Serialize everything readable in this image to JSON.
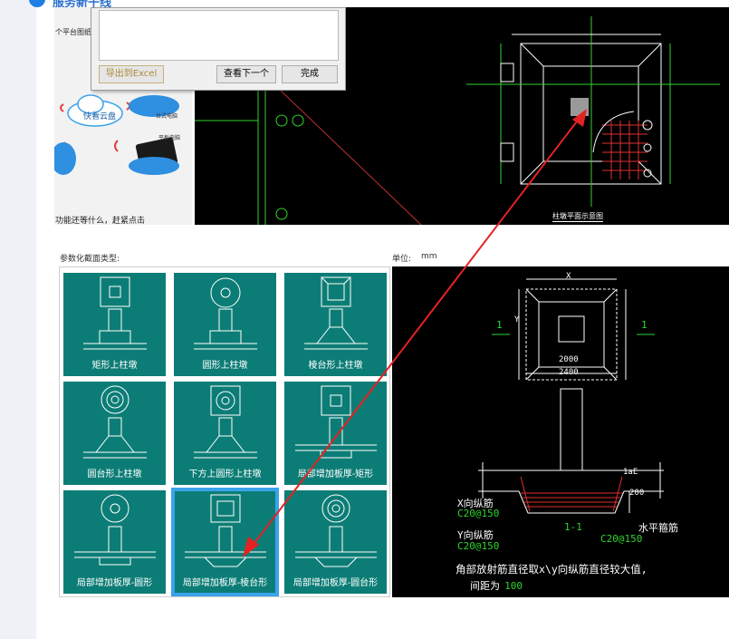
{
  "top": {
    "brand": "服务新干线"
  },
  "left_panel": {
    "title": "个平台图纸",
    "cloud_label": "快看云盘",
    "device_label_1": "台式电脑",
    "device_label_2": "平板电脑",
    "footer_text": "功能还等什么，赶紧点击"
  },
  "dialog": {
    "export_label": "导出到Excel",
    "next_label": "查看下一个",
    "done_label": "完成"
  },
  "cad_top": {
    "label_1": "柱墩平面示意图"
  },
  "section_title": "参数化截面类型:",
  "unit_label": "单位:",
  "unit_value": "mm",
  "tiles": [
    {
      "label": "矩形上柱墩"
    },
    {
      "label": "圆形上柱墩"
    },
    {
      "label": "棱台形上柱墩"
    },
    {
      "label": "圆台形上柱墩"
    },
    {
      "label": "下方上圆形上柱墩"
    },
    {
      "label": "局部增加板厚-矩形"
    },
    {
      "label": "局部增加板厚-圆形"
    },
    {
      "label": "局部增加板厚-棱台形"
    },
    {
      "label": "局部增加板厚-圆台形"
    }
  ],
  "detail": {
    "dim_x": "X",
    "dim_y": "Y",
    "dim_2000": "2000",
    "dim_2400": "2400",
    "dim_200": "200",
    "dim_1ae": "1aE",
    "section_mark": "1",
    "section_label": "1-1",
    "x_rebar_label": "X向纵筋",
    "x_rebar_spec": "C20@150",
    "y_rebar_label": "Y向纵筋",
    "y_rebar_spec": "C20@150",
    "h_stirrup_label": "水平箍筋",
    "h_stirrup_spec": "C20@150",
    "note_line1": "角部放射筋直径取x\\y向纵筋直径较大值,",
    "note_line2": "间距为",
    "note_value": "100"
  },
  "colors": {
    "tile_bg": "#0c7d76",
    "selected_border": "#3aa3ea",
    "arrow": "#e52222",
    "cad_green": "#2fd52f"
  }
}
